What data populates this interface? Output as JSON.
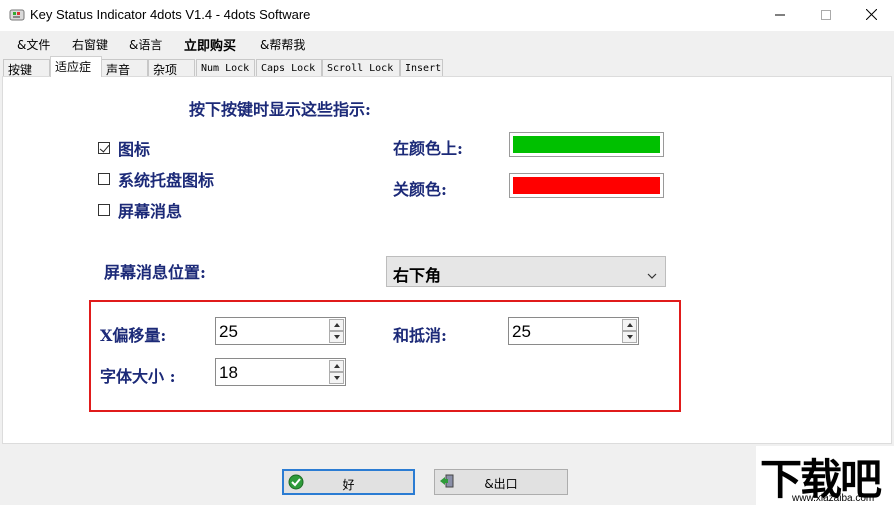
{
  "window": {
    "title": "Key Status Indicator 4dots V1.4 - 4dots Software",
    "controls": {
      "minimize": "minimize-icon",
      "maximize": "maximize-icon",
      "close": "close-icon"
    }
  },
  "menu": {
    "items": [
      {
        "label": "&文件"
      },
      {
        "label": "右窗键"
      },
      {
        "label": "&语言"
      },
      {
        "label": "立即购买"
      },
      {
        "label": "&帮帮我"
      }
    ]
  },
  "tabs": [
    {
      "label": "按键"
    },
    {
      "label": "适应症",
      "active": true
    },
    {
      "label": "声音"
    },
    {
      "label": "杂项"
    },
    {
      "label": "Num Lock"
    },
    {
      "label": "Caps Lock"
    },
    {
      "label": "Scroll Lock"
    },
    {
      "label": "Insert"
    }
  ],
  "indicators": {
    "heading": "按下按键时显示这些指示:",
    "options": [
      {
        "label": "图标",
        "checked": true
      },
      {
        "label": "系统托盘图标",
        "checked": false
      },
      {
        "label": "屏幕消息",
        "checked": false
      }
    ],
    "on_color_label": "在颜色上:",
    "off_color_label": "关颜色:",
    "on_color": "#00c000",
    "off_color": "#ff0000"
  },
  "position": {
    "label": "屏幕消息位置:",
    "selected": "右下角"
  },
  "offsets": {
    "x_label": "X偏移量:",
    "x_value": "25",
    "y_label": "和抵消:",
    "y_value": "25",
    "font_size_label": "字体大小 :",
    "font_size_value": "18"
  },
  "buttons": {
    "ok_label": "好",
    "exit_label": "&出口"
  },
  "watermark": {
    "text": "下载吧",
    "url": "www.xiazaiba.com"
  },
  "colors": {
    "label_blue": "#1c2a78",
    "highlight_red": "#e01b1b",
    "default_button_border": "#2b7cd3"
  }
}
